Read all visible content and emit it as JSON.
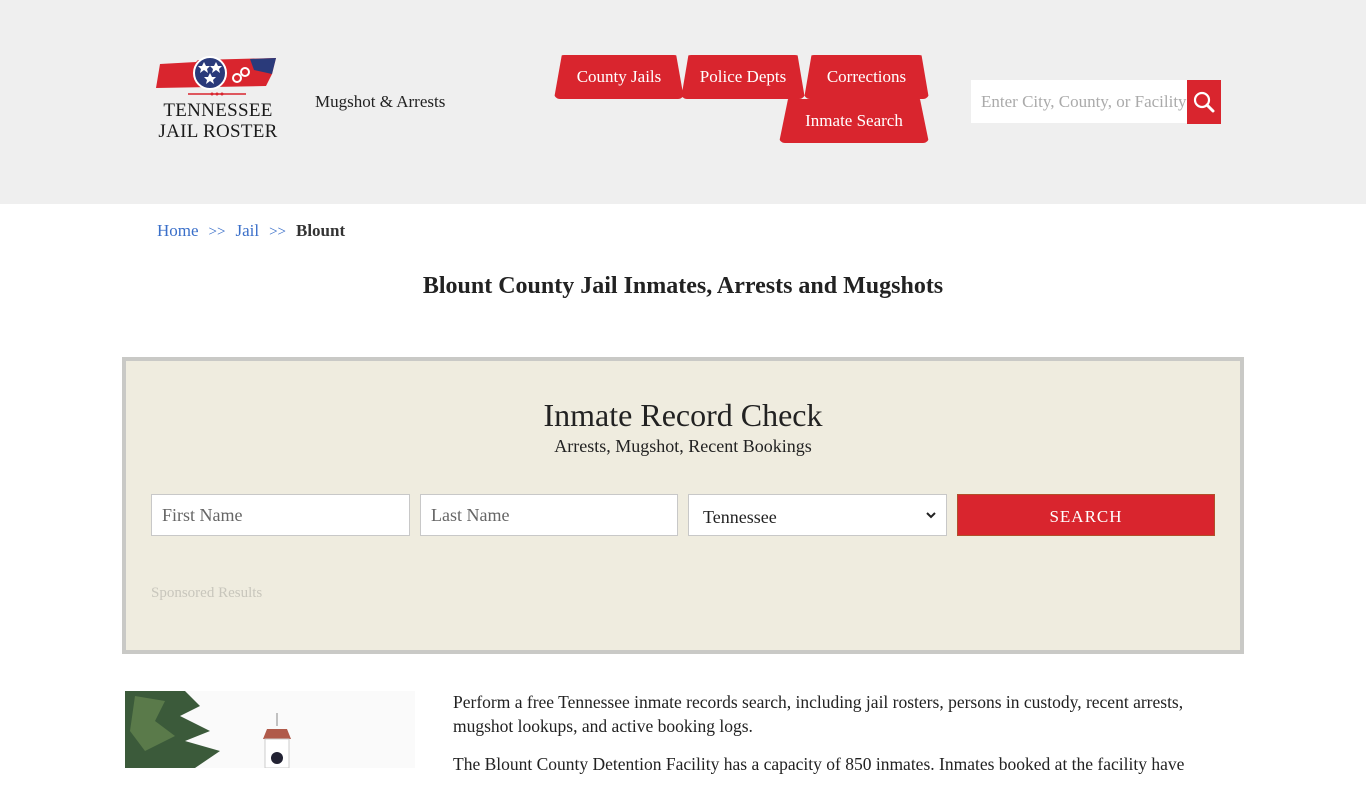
{
  "header": {
    "logo": {
      "line1": "TENNESSEE",
      "line2": "JAIL ROSTER",
      "icon": "tennessee-state-flag-map-icon"
    },
    "tagline": "Mugshot & Arrests",
    "nav": [
      {
        "label": "County Jails"
      },
      {
        "label": "Police Depts"
      },
      {
        "label": "Corrections"
      },
      {
        "label": "Inmate Search"
      }
    ],
    "search": {
      "placeholder": "Enter City, County, or Facility",
      "value": "",
      "icon": "search-icon"
    }
  },
  "breadcrumb": {
    "items": [
      {
        "label": "Home"
      },
      {
        "label": "Jail"
      },
      {
        "label": "Blount"
      }
    ],
    "separator": ">>"
  },
  "page": {
    "title": "Blount County Jail Inmates, Arrests and Mugshots"
  },
  "record_check": {
    "title": "Inmate Record Check",
    "subtitle": "Arrests, Mugshot, Recent Bookings",
    "first_name_placeholder": "First Name",
    "last_name_placeholder": "Last Name",
    "state_selected": "Tennessee",
    "search_label": "SEARCH",
    "sponsored_label": "Sponsored Results"
  },
  "content": {
    "photo_alt": "Blount County courthouse clock tower",
    "paragraphs": [
      "Perform a free Tennessee inmate records search, including jail rosters, persons in custody, recent arrests, mugshot lookups, and active booking logs.",
      "The Blount County Detention Facility has a capacity of 850 inmates. Inmates booked at the facility have"
    ]
  },
  "colors": {
    "brand_red": "#d9252e",
    "header_bg": "#efefef",
    "panel_bg": "#efecdf",
    "link_blue": "#3a6fc9"
  }
}
